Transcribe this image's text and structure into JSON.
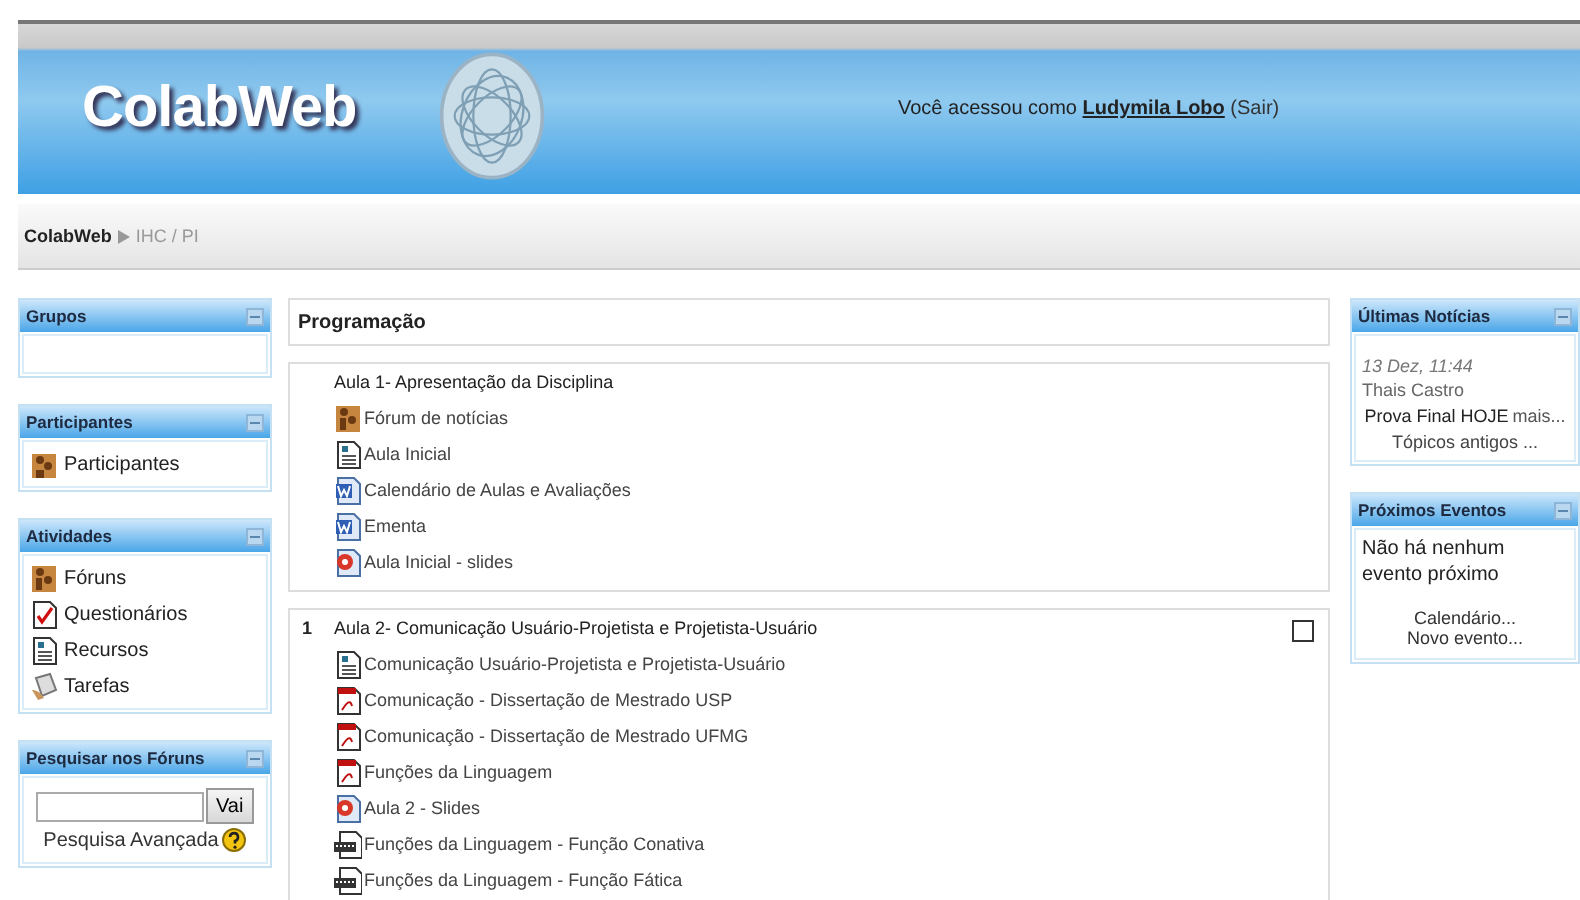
{
  "header": {
    "logo": "ColabWeb",
    "login_prefix": "Você acessou como",
    "user": "Ludymila Lobo",
    "logout": "(Sair)"
  },
  "breadcrumb": [
    {
      "label": "ColabWeb",
      "current": false
    },
    {
      "label": "IHC / PI",
      "current": true
    }
  ],
  "left_blocks": [
    {
      "kind": "empty",
      "title": "Grupos"
    },
    {
      "kind": "list",
      "title": "Participantes",
      "items": [
        {
          "kind": "people",
          "label": "Participantes"
        }
      ]
    },
    {
      "kind": "list",
      "title": "Atividades",
      "items": [
        {
          "kind": "forum",
          "label": "Fóruns"
        },
        {
          "kind": "quiz",
          "label": "Questionários"
        },
        {
          "kind": "page",
          "label": "Recursos"
        },
        {
          "kind": "assignment",
          "label": "Tarefas"
        }
      ]
    },
    {
      "kind": "search",
      "title": "Pesquisar nos Fóruns",
      "button": "Vai",
      "link": "Pesquisa Avançada"
    }
  ],
  "center": {
    "title": "Programação",
    "sections": [
      {
        "title": "Aula 1- Apresentação da Disciplina",
        "items": [
          {
            "kind": "forum",
            "label": "Fórum de notícias"
          },
          {
            "kind": "page",
            "label": "Aula Inicial"
          },
          {
            "kind": "doc",
            "label": "Calendário de Aulas e Avaliações"
          },
          {
            "kind": "doc",
            "label": "Ementa"
          },
          {
            "kind": "slides",
            "label": "Aula Inicial - slides"
          }
        ]
      },
      {
        "number": "1",
        "title": "Aula 2- Comunicação Usuário-Projetista e Projetista-Usuário",
        "items": [
          {
            "kind": "page",
            "label": "Comunicação Usuário-Projetista e Projetista-Usuário"
          },
          {
            "kind": "pdf",
            "label": "Comunicação - Dissertação de Mestrado USP"
          },
          {
            "kind": "pdf",
            "label": "Comunicação - Dissertação de Mestrado UFMG"
          },
          {
            "kind": "pdf",
            "label": "Funções da Linguagem"
          },
          {
            "kind": "slides",
            "label": "Aula 2 - Slides"
          },
          {
            "kind": "media",
            "label": "Funções da Linguagem - Função Conativa"
          },
          {
            "kind": "media",
            "label": "Funções da Linguagem - Função Fática"
          }
        ]
      }
    ]
  },
  "right_blocks": [
    {
      "kind": "news",
      "title": "Últimas Notícias",
      "date": "13 Dez, 11:44",
      "author": "Thais Castro",
      "post": "Prova Final HOJE",
      "more": "mais...",
      "link": "Tópicos antigos ..."
    },
    {
      "kind": "events",
      "title": "Próximos Eventos",
      "text": "Não há nenhum evento próximo",
      "links": [
        "Calendário...",
        "Novo evento..."
      ]
    }
  ]
}
